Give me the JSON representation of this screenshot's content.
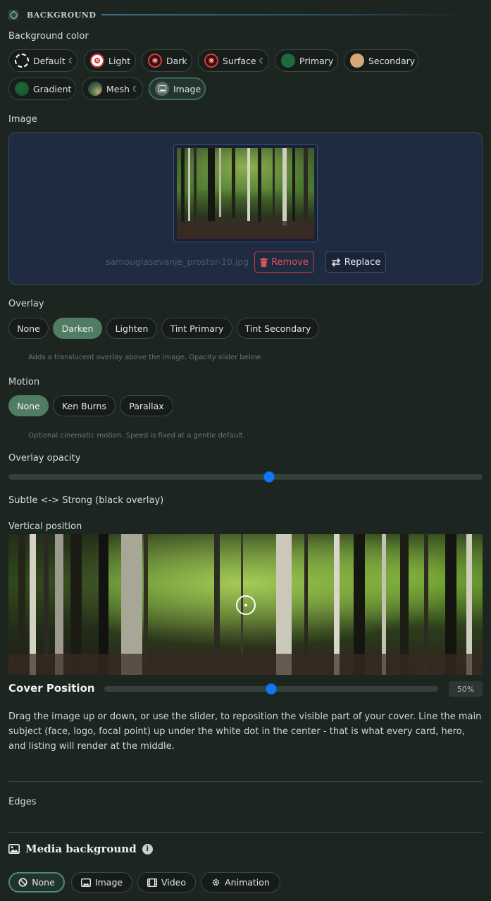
{
  "section": {
    "title": "BACKGROUND",
    "icon": "paint-bucket-icon"
  },
  "background_color": {
    "label": "Background color",
    "options": [
      {
        "label": "Default",
        "swatch": "dashed-white",
        "dark_mode": true
      },
      {
        "label": "Light",
        "swatch": "#ffffff",
        "disabled": true
      },
      {
        "label": "Dark",
        "swatch": "#2a1515",
        "disabled": true
      },
      {
        "label": "Surface",
        "swatch": "#2a1515",
        "disabled": true,
        "dark_mode": true
      },
      {
        "label": "Primary",
        "swatch": "#1d6b3a"
      },
      {
        "label": "Secondary",
        "swatch": "#d8a878"
      },
      {
        "label": "Gradient",
        "swatch": "#1f6a38"
      },
      {
        "label": "Mesh",
        "swatch": "mesh",
        "dark_mode": true
      },
      {
        "label": "Image",
        "swatch": "image-icon",
        "selected": true
      }
    ]
  },
  "image": {
    "label": "Image",
    "filename": "samougiasevanje_prostor-10.jpg",
    "remove_label": "Remove",
    "replace_label": "Replace"
  },
  "overlay": {
    "label": "Overlay",
    "options": [
      "None",
      "Darken",
      "Lighten",
      "Tint Primary",
      "Tint Secondary"
    ],
    "selected": "Darken",
    "hint": "Adds a translucent overlay above the image. Opacity slider below."
  },
  "motion": {
    "label": "Motion",
    "options": [
      "None",
      "Ken Burns",
      "Parallax"
    ],
    "selected": "None",
    "hint": "Optional cinematic motion. Speed is fixed at a gentle default."
  },
  "overlay_opacity": {
    "label": "Overlay opacity",
    "value": 0.55,
    "caption": "Subtle <-> Strong (black overlay)"
  },
  "vertical_position": {
    "label": "Vertical position",
    "cover_label": "Cover Position",
    "value_percent": 50,
    "value_text": "50%",
    "description": "Drag the image up or down, or use the slider, to reposition the visible part of your cover. Line the main subject (face, logo, focal point) up under the white dot in the center - that is what every card, hero, and listing will render at the middle."
  },
  "edges": {
    "label": "Edges"
  },
  "media_background": {
    "title": "Media background",
    "info": "i",
    "options": [
      {
        "label": "None",
        "icon": "ban-icon",
        "selected": true
      },
      {
        "label": "Image",
        "icon": "image-icon"
      },
      {
        "label": "Video",
        "icon": "film-icon"
      },
      {
        "label": "Animation",
        "icon": "gear-icon"
      }
    ]
  },
  "colors": {
    "accent_green": "#4f7c62",
    "slider_blue": "#1477f0",
    "danger_red": "#e0505a"
  }
}
